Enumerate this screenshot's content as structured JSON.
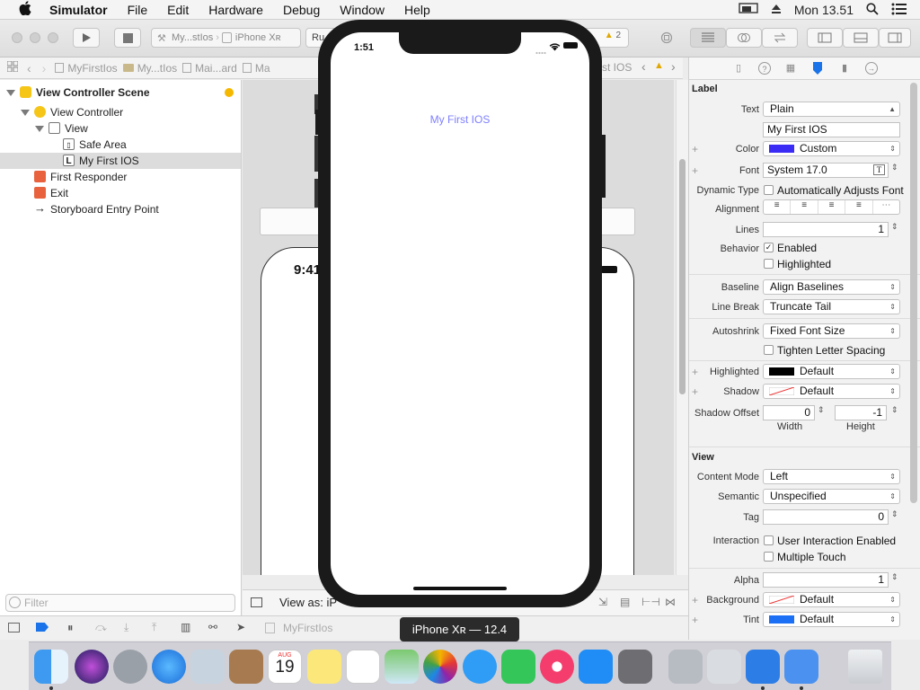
{
  "menubar": {
    "apple": "",
    "app_name": "Simulator",
    "items": [
      "File",
      "Edit",
      "Hardware",
      "Debug",
      "Window",
      "Help"
    ],
    "clock": "Mon 13.51"
  },
  "toolbar": {
    "scheme_project": "My...stIos",
    "scheme_device": "iPhone Xʀ",
    "status_prefix": "Ru",
    "warning_count": "2"
  },
  "jumpbar": {
    "crumbs": [
      "MyFirstIos",
      "My...tIos",
      "Mai...ard",
      "Ma"
    ],
    "tail": "st IOS"
  },
  "navigator": {
    "items": [
      {
        "label": "View Controller Scene",
        "bold": true
      },
      {
        "label": "View Controller"
      },
      {
        "label": "View"
      },
      {
        "label": "Safe Area"
      },
      {
        "label": "My First IOS",
        "selected": true
      },
      {
        "label": "First Responder"
      },
      {
        "label": "Exit"
      },
      {
        "label": "Storyboard Entry Point"
      }
    ],
    "filter_placeholder": "Filter"
  },
  "canvas": {
    "behind_time": "9:41",
    "view_as_label": "View as: iP"
  },
  "simulator": {
    "status_time": "1:51",
    "label_text": "My First IOS",
    "label_color": "#7f80ff",
    "device_tooltip": "iPhone Xʀ — 12.4"
  },
  "inspector": {
    "label_section": "Label",
    "view_section": "View",
    "text_label": "Text",
    "text_value": "Plain",
    "text_content": "My First IOS",
    "color_label": "Color",
    "color_value": "Custom",
    "color_swatch": "#3a2bf5",
    "font_label": "Font",
    "font_value": "System 17.0",
    "dynamic_type_label": "Dynamic Type",
    "dynamic_type_value": "Automatically Adjusts Font",
    "alignment_label": "Alignment",
    "lines_label": "Lines",
    "lines_value": "1",
    "behavior_label": "Behavior",
    "enabled_label": "Enabled",
    "highlighted_check_label": "Highlighted",
    "baseline_label": "Baseline",
    "baseline_value": "Align Baselines",
    "line_break_label": "Line Break",
    "line_break_value": "Truncate Tail",
    "autoshrink_label": "Autoshrink",
    "autoshrink_value": "Fixed Font Size",
    "tighten_label": "Tighten Letter Spacing",
    "highlighted_label": "Highlighted",
    "highlighted_value": "Default",
    "shadow_label": "Shadow",
    "shadow_value": "Default",
    "shadow_offset_label": "Shadow Offset",
    "shadow_width": "0",
    "shadow_height": "-1",
    "width_label": "Width",
    "height_label": "Height",
    "content_mode_label": "Content Mode",
    "content_mode_value": "Left",
    "semantic_label": "Semantic",
    "semantic_value": "Unspecified",
    "tag_label": "Tag",
    "tag_value": "0",
    "interaction_label": "Interaction",
    "user_interaction_label": "User Interaction Enabled",
    "multiple_touch_label": "Multiple Touch",
    "alpha_label": "Alpha",
    "alpha_value": "1",
    "background_label": "Background",
    "background_value": "Default",
    "tint_label": "Tint",
    "tint_value": "Default",
    "tint_swatch": "#1a6ff5"
  },
  "debugbar": {
    "target": "MyFirstIos"
  },
  "dock": {
    "calendar_month": "AUG",
    "calendar_day": "19"
  }
}
